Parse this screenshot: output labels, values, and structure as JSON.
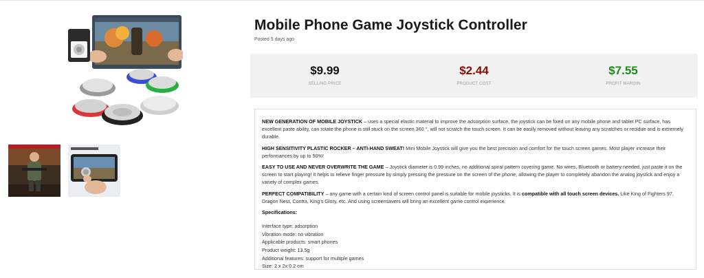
{
  "product": {
    "title": "Mobile Phone Game Joystick Controller",
    "posted": "Posted 5 days ago"
  },
  "stats": [
    {
      "value": "$9.99",
      "label": "SELLING PRICE",
      "color": "#111111"
    },
    {
      "value": "$2.44",
      "label": "PRODUCT COST",
      "color": "#8b0b0b"
    },
    {
      "value": "$7.55",
      "label": "PROFIT MARGIN",
      "color": "#1e8a1e"
    }
  ],
  "description": {
    "p1_title": "NEW GENERATION OF MOBILE JOYSTICK",
    "p1_text": " – uses a special elastic material to improve the adsorption surface, the joystick can be fixed on any mobile phone and tablet PC surface, has excellent paste ability, can rotate the phone is still stuck on the screen 360 °, will not scratch the touch screen. It can be easily removed without leaving any scratches or residue and is extremely durable.",
    "p2_title": "HIGH SENSITIVITY PLASTIC ROCKER – ANTI-HAND SWEAT!",
    "p2_text": " Mini Mobile Joystick will give you the best precision and comfort for the touch screen games. Most player increase their performances by up to 50%!",
    "p3_title": "EASY TO USE AND NEVER OVERWRITE THE GAME",
    "p3_text": " – Joystick diameter is 0.99 inches, no additional spiral pattern covering game. No wires, Bluetooth or battery needed, just paste it on the screen to start playing! It helps to relieve finger pressure by simply pressing the pressure on the screen of the phone, allowing the player to completely abandon the analog joystick and enjoy a variety of complex games.",
    "p4_title": "PERFECT COMPATIBILITY",
    "p4_text_a": " – any game with a certain kind of screen control panel is suitable for mobile joysticks. It is ",
    "p4_bold": "compatible with all touch screen devices.",
    "p4_text_b": " Like King of Fighters 97, Dragon Nest, Contra, King's Glory, etc. And using screensavers will bring an excellent game control experience.",
    "spec_title": "Specifications:",
    "specs": [
      "Interface type: adsorption",
      "Vibration mode: no vibration",
      "Applicable products: smart phones",
      "Product weight: 13.5g",
      "Additional features: support for multiple games",
      "Size: 2 x 2x 0.2 cm"
    ]
  },
  "images": {
    "main": "joystick-product-image",
    "thumb1": "game-soldier-thumbnail",
    "thumb2": "hand-joystick-thumbnail"
  }
}
